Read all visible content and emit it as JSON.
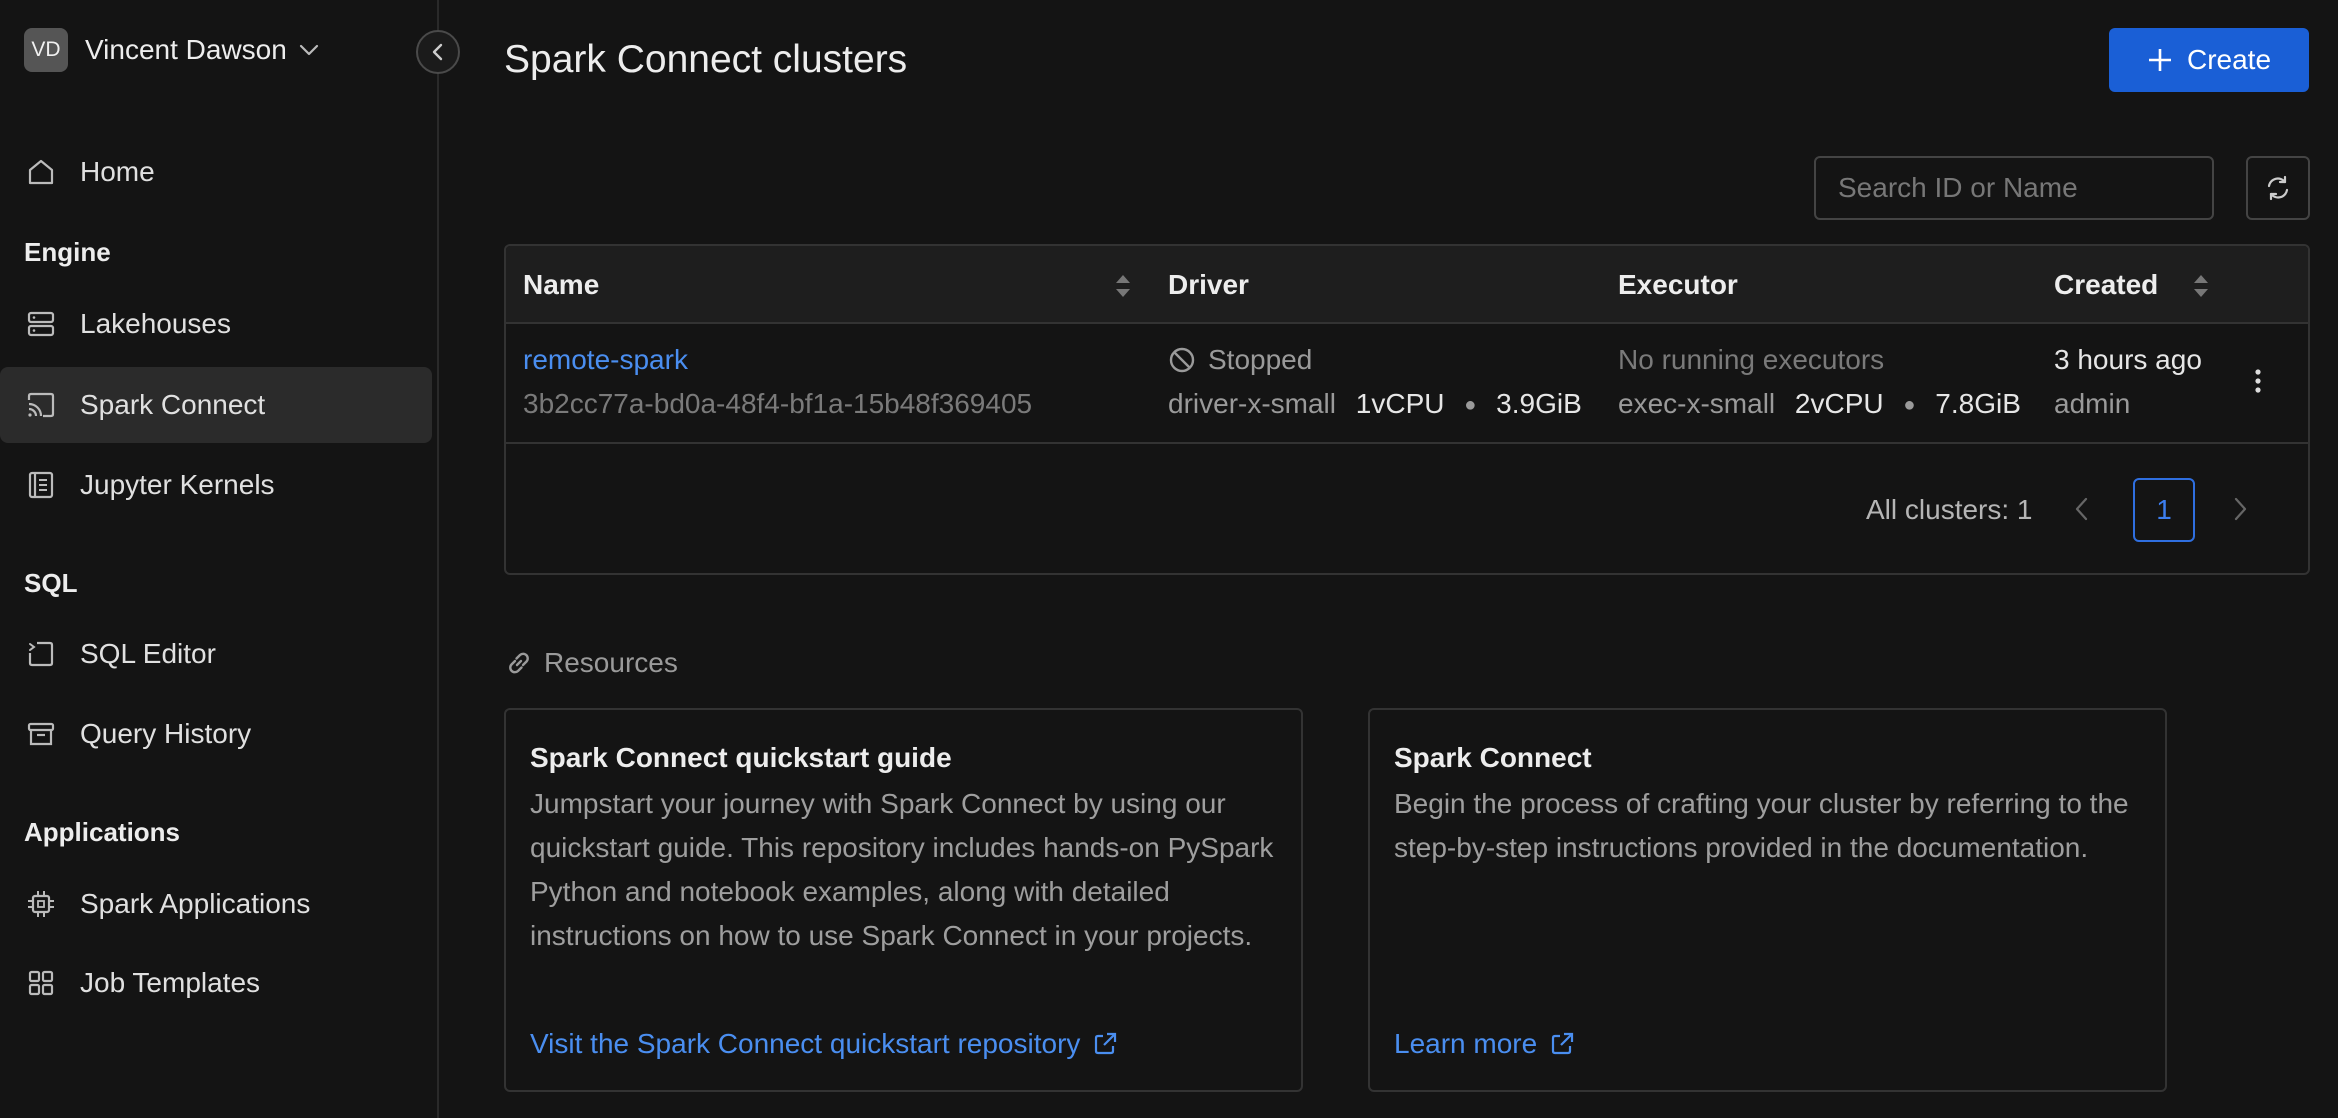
{
  "user": {
    "initials": "VD",
    "name": "Vincent Dawson"
  },
  "nav": {
    "home": "Home",
    "engine_section": "Engine",
    "lakehouses": "Lakehouses",
    "spark_connect": "Spark Connect",
    "jupyter_kernels": "Jupyter Kernels",
    "sql_section": "SQL",
    "sql_editor": "SQL Editor",
    "query_history": "Query History",
    "applications_section": "Applications",
    "spark_applications": "Spark Applications",
    "job_templates": "Job Templates"
  },
  "page": {
    "title": "Spark Connect clusters",
    "create_label": "Create"
  },
  "search": {
    "placeholder": "Search ID or Name"
  },
  "table": {
    "columns": {
      "name": "Name",
      "driver": "Driver",
      "executor": "Executor",
      "created": "Created"
    },
    "rows": [
      {
        "name": "remote-spark",
        "id": "3b2cc77a-bd0a-48f4-bf1a-15b48f369405",
        "status": "Stopped",
        "driver_size": "driver-x-small",
        "driver_cpu": "1vCPU",
        "driver_mem": "3.9GiB",
        "executor_status": "No running executors",
        "executor_size": "exec-x-small",
        "executor_cpu": "2vCPU",
        "executor_mem": "7.8GiB",
        "created": "3 hours ago",
        "created_by": "admin"
      }
    ]
  },
  "pagination": {
    "label": "All clusters: 1",
    "current_page": "1"
  },
  "resources": {
    "title": "Resources",
    "cards": [
      {
        "title": "Spark Connect quickstart guide",
        "description": "Jumpstart your journey with Spark Connect by using our quickstart guide. This repository includes hands-on PySpark Python and notebook examples, along with detailed instructions on how to use Spark Connect in your projects.",
        "link": "Visit the Spark Connect quickstart repository"
      },
      {
        "title": "Spark Connect",
        "description": "Begin the process of crafting your cluster by referring to the step-by-step instructions provided in the documentation.",
        "link": "Learn more"
      }
    ]
  },
  "colors": {
    "accent": "#1a5fd6",
    "link": "#4a8ef0",
    "background": "#141414"
  }
}
